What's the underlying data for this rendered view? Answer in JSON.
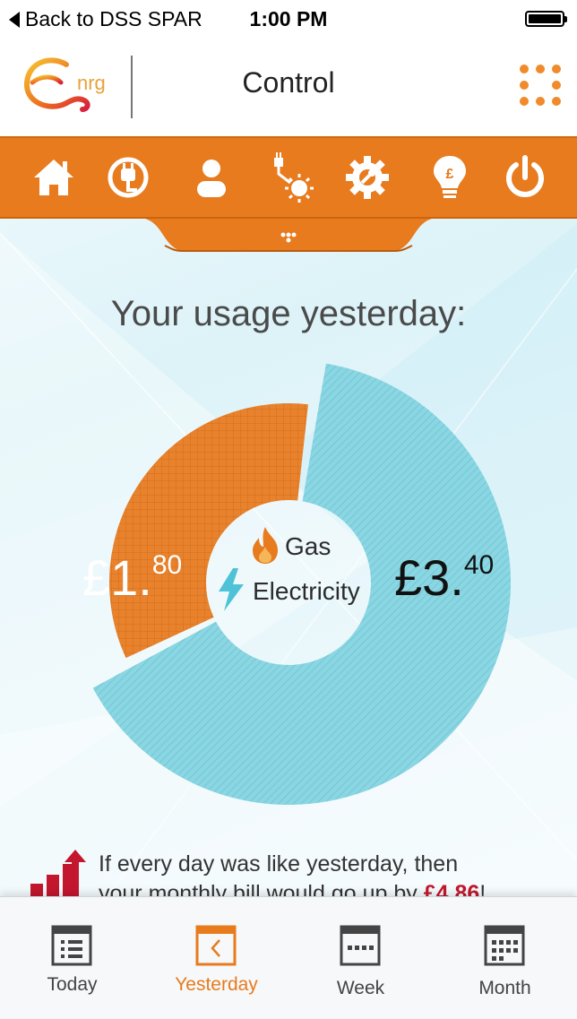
{
  "status_bar": {
    "back_label": "Back to DSS SPAR",
    "time": "1:00 PM"
  },
  "header": {
    "logo_word": "nrg",
    "title": "Control"
  },
  "toolbar": {
    "icons": [
      "home-icon",
      "plug-icon",
      "user-icon",
      "solar-plug-icon",
      "settings-icon",
      "bulb-pound-icon",
      "power-icon"
    ]
  },
  "usage": {
    "heading": "Your usage yesterday:",
    "gas_amount_main": "£1.",
    "gas_amount_pence": "80",
    "electricity_amount_main": "£3.",
    "electricity_amount_pence": "40",
    "legend_gas": "Gas",
    "legend_electricity": "Electricity"
  },
  "chart_data": {
    "type": "pie",
    "categories": [
      "Gas",
      "Electricity"
    ],
    "values": [
      1.8,
      3.4
    ],
    "colors": {
      "Gas": "#e8822c",
      "Electricity": "#8ad6e2"
    }
  },
  "projection": {
    "line1": "If every day was like yesterday, then",
    "line2_prefix": "your monthly bill would go up by ",
    "amount": "£4.86",
    "line2_suffix": "!"
  },
  "tabs": [
    {
      "label": "Today",
      "icon": "list-calendar-icon",
      "active": false
    },
    {
      "label": "Yesterday",
      "icon": "back-calendar-icon",
      "active": true
    },
    {
      "label": "Week",
      "icon": "week-calendar-icon",
      "active": false
    },
    {
      "label": "Month",
      "icon": "month-calendar-icon",
      "active": false
    }
  ],
  "colors": {
    "accent": "#e77b1e",
    "electric": "#8ad6e2",
    "alert": "#c3172f"
  }
}
